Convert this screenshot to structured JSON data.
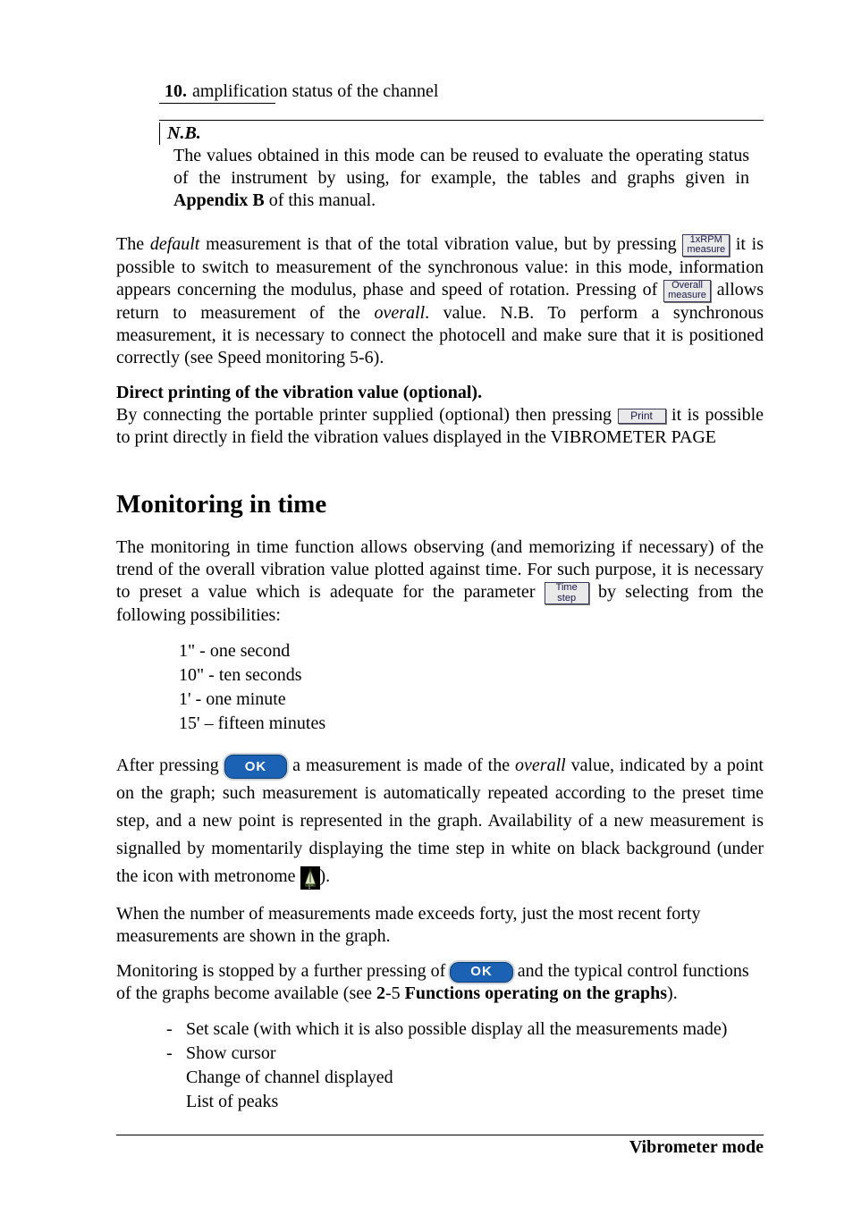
{
  "list": {
    "num": "10.",
    "text": "amplification status of the channel"
  },
  "nb": {
    "header": "N.B.",
    "body_part1": "The values obtained in this mode can be reused to evaluate the operating status of the instrument by using, for example, the tables and graphs given in ",
    "body_bold": "Appendix B",
    "body_part2": " of this manual."
  },
  "p1": {
    "t1": "The ",
    "default_word": "default",
    "t2": " measurement is that of the total vibration value, but by pressing ",
    "btn1_l1": "1xRPM",
    "btn1_l2": "measure",
    "t3": " it is possible to switch to measurement of the synchronous value: in this mode, information appears concerning the modulus, phase and speed of rotation. Pressing of ",
    "btn2_l1": "Overall",
    "btn2_l2": "measure",
    "t4": " allows return to measurement of the ",
    "overall_word": "overall",
    "t5": ". value. N.B. To perform a synchronous measurement, it is necessary to connect the photocell and make sure that it is positioned correctly (see Speed monitoring 5-6)."
  },
  "direct": {
    "heading": "Direct printing of the vibration value (optional).",
    "t1": "By connecting the portable printer supplied (optional) then pressing ",
    "btn_print": "Print",
    "t2": " it is possible to print directly in field the vibration values displayed in the VIBROMETER PAGE"
  },
  "section_title": "Monitoring in time",
  "mon": {
    "t1": "The monitoring in time function allows observing (and memorizing if necessary) of the trend of the overall vibration value plotted against time. For such purpose, it is necessary to preset a value which is adequate for the parameter ",
    "btn_time_l1": "Time",
    "btn_time_l2": "step",
    "t2": " by selecting from the following possibilities:"
  },
  "time_options": [
    "1\" - one second",
    "10\" - ten seconds",
    "1' - one minute",
    "15' – fifteen minutes"
  ],
  "after": {
    "t1": "After pressing ",
    "ok": "OK",
    "t2": " a measurement is made of the ",
    "overall_word": "overall",
    "t3": " value, indicated by a point on the graph; such measurement is automatically repeated according to the preset time step, and a new point is represented in the graph. Availability of a new measurement is signalled by momentarily displaying the time step in white on black background (under the icon with metronome ",
    "t4": ")."
  },
  "forty": "When the number of measurements made exceeds forty, just the most recent forty measurements are shown in the graph.",
  "stop": {
    "t1": "Monitoring is stopped by a further pressing of ",
    "ok": "OK",
    "t2": " and the typical control functions of the graphs become available (see  ",
    "ref_bold1": "2",
    "ref_mid": "-5 ",
    "ref_bold2": "Functions operating on the graphs",
    "t3": ")."
  },
  "bullets": [
    "Set scale (with which it is also possible display all the measurements made)",
    "Show cursor",
    "Change of channel displayed",
    "List of peaks"
  ],
  "footer": "Vibrometer mode"
}
